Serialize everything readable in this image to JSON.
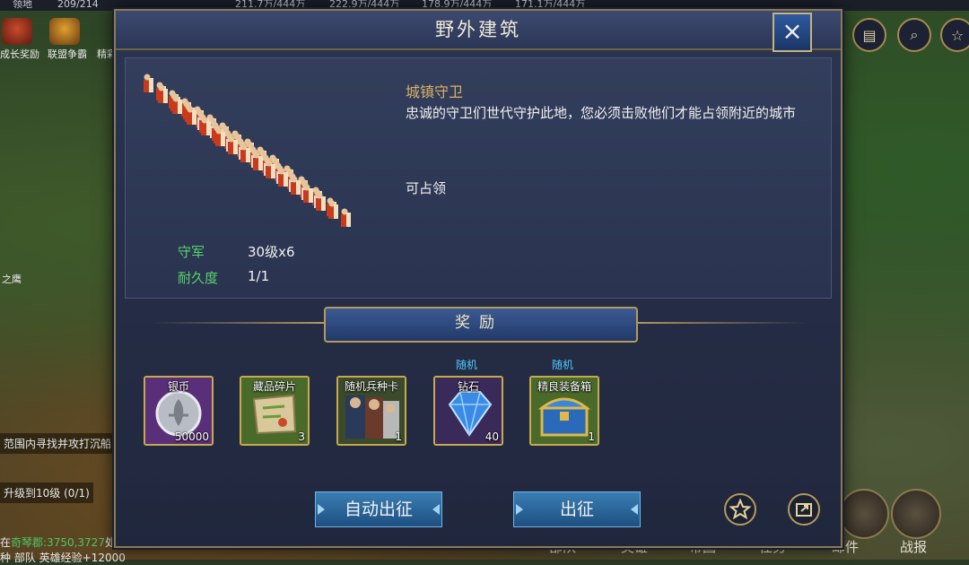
{
  "top_bar": {
    "territory_label": "领地",
    "territory_count": "209/214",
    "resource_1": "211.7万/444万",
    "resource_2": "222.9万/444万",
    "resource_3": "178.9万/444万",
    "resource_4": "171.1万/444万"
  },
  "left_panel": {
    "growth_reward": "成长奖励",
    "alliance_war": "联盟争霸",
    "extra_partial": "精彩",
    "eagle_text": "之鹰",
    "quest_1": "范围内寻找并攻打沉船",
    "quest_2": "升级到10级 (0/1)",
    "location_prefix": "在",
    "location_name": "奇琴郡:3750,3727",
    "location_suffix": "处",
    "exp_text": "种 部队 英雄经验+12000"
  },
  "bottom_nav": {
    "troops": "部队",
    "heroes": "英雄",
    "empire": "帝国",
    "tasks": "任务",
    "mail": "邮件",
    "battle_report": "战报"
  },
  "dialog": {
    "title": "野外建筑",
    "close_label": "×",
    "building_name": "城镇守卫",
    "description": "忠诚的守卫们世代守护此地，您必须击败他们才能占领附近的城市",
    "capture_status": "可占领",
    "garrison_label": "守军",
    "garrison_value": "30级x6",
    "durability_label": "耐久度",
    "durability_value": "1/1",
    "reward_title": "奖励",
    "auto_march_label": "自动出征",
    "march_label": "出征"
  },
  "rewards": [
    {
      "name": "银币",
      "count": "50000",
      "random": "",
      "color": "#6a3a8a"
    },
    {
      "name": "藏品碎片",
      "count": "3",
      "random": "",
      "color": "#4a6a2a"
    },
    {
      "name": "随机兵种卡",
      "count": "1",
      "random": "",
      "color": "#4a5a2a"
    },
    {
      "name": "钻石",
      "count": "40",
      "random": "随机",
      "color": "#3a2a5a"
    },
    {
      "name": "精良装备箱",
      "count": "1",
      "random": "随机",
      "color": "#4a6a2a"
    }
  ]
}
